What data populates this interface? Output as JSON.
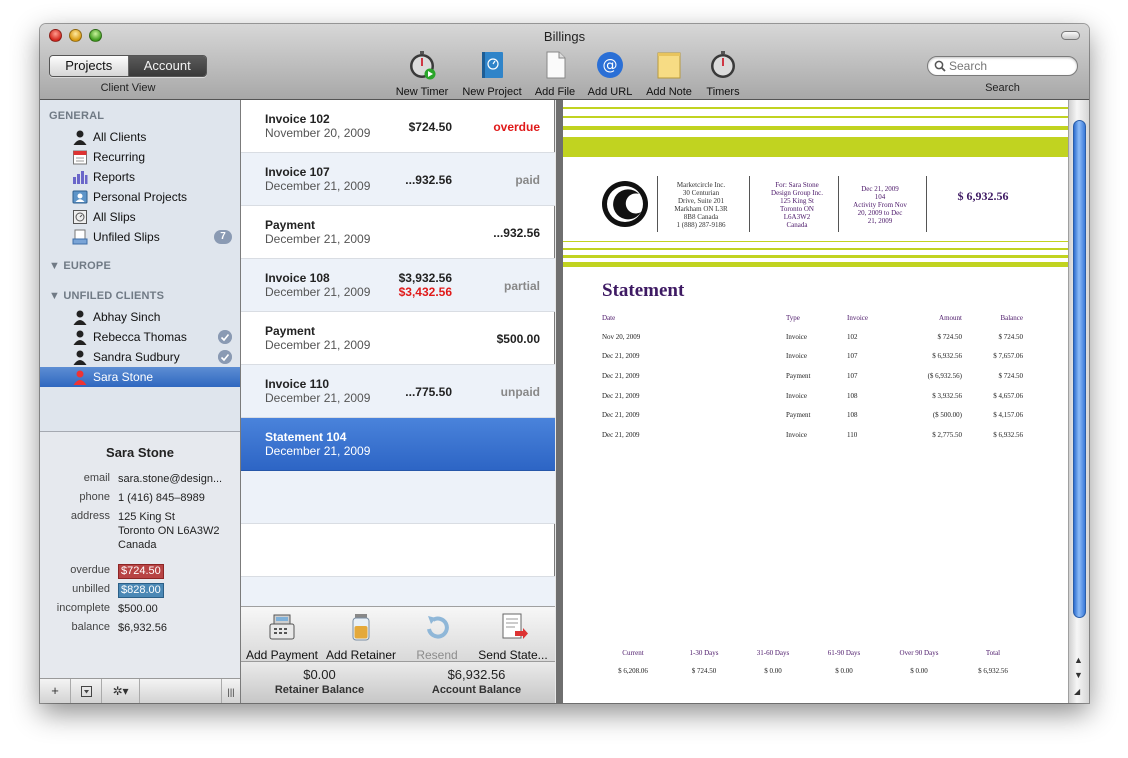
{
  "window": {
    "title": "Billings"
  },
  "toolbar": {
    "seg_projects": "Projects",
    "seg_account": "Account",
    "client_view": "Client View",
    "new_timer": "New Timer",
    "new_project": "New Project",
    "add_file": "Add File",
    "add_url": "Add URL",
    "add_note": "Add Note",
    "timers": "Timers",
    "search_placeholder": "Search",
    "search_label": "Search"
  },
  "sidebar": {
    "general": "GENERAL",
    "items": [
      {
        "label": "All Clients",
        "icon": "person-icon"
      },
      {
        "label": "Recurring",
        "icon": "calendar-icon"
      },
      {
        "label": "Reports",
        "icon": "bar-chart-icon"
      },
      {
        "label": "Personal Projects",
        "icon": "contact-card-icon"
      },
      {
        "label": "All Slips",
        "icon": "slips-icon"
      },
      {
        "label": "Unfiled Slips",
        "icon": "tray-icon",
        "badge": "7"
      }
    ],
    "europe": "EUROPE",
    "unfiled_clients": "UNFILED CLIENTS",
    "clients": [
      {
        "label": "Abhay Sinch"
      },
      {
        "label": "Rebecca Thomas"
      },
      {
        "label": "Sandra Sudbury"
      },
      {
        "label": "Sara Stone"
      }
    ]
  },
  "client": {
    "name": "Sara Stone",
    "email_label": "email",
    "email": "sara.stone@design...",
    "phone_label": "phone",
    "phone": "1 (416) 845–8989",
    "address_label": "address",
    "address_1": "125 King St",
    "address_2": "Toronto ON L6A3W2",
    "address_3": "Canada",
    "overdue_label": "overdue",
    "overdue": "$724.50",
    "unbilled_label": "unbilled",
    "unbilled": "$828.00",
    "incomplete_label": "incomplete",
    "incomplete": "$500.00",
    "balance_label": "balance",
    "balance": "$6,932.56"
  },
  "transactions": [
    {
      "title": "Invoice 102",
      "date": "November 20, 2009",
      "amount": "$724.50",
      "amount2": "",
      "status": "overdue"
    },
    {
      "title": "Invoice 107",
      "date": "December 21, 2009",
      "amount": "...932.56",
      "amount2": "",
      "status": "paid"
    },
    {
      "title": "Payment",
      "date": "December 21, 2009",
      "amount": "...932.56",
      "amount2": "",
      "status": ""
    },
    {
      "title": "Invoice 108",
      "date": "December 21, 2009",
      "amount": "$3,932.56",
      "amount2": "$3,432.56",
      "status": "partial"
    },
    {
      "title": "Payment",
      "date": "December 21, 2009",
      "amount": "$500.00",
      "amount2": "",
      "status": ""
    },
    {
      "title": "Invoice 110",
      "date": "December 21, 2009",
      "amount": "...775.50",
      "amount2": "",
      "status": "unpaid"
    },
    {
      "title": "Statement 104",
      "date": "December 21, 2009",
      "amount": "",
      "amount2": "",
      "status": ""
    }
  ],
  "actions": {
    "add_payment": "Add Payment",
    "add_retainer": "Add Retainer",
    "resend": "Resend",
    "send_statement": "Send State..."
  },
  "balances": {
    "retainer_value": "$0.00",
    "retainer_label": "Retainer Balance",
    "account_value": "$6,932.56",
    "account_label": "Account Balance"
  },
  "statement": {
    "from_1": "Marketcircle Inc.",
    "from_2": "30 Centurian",
    "from_3": "Drive, Suite 201",
    "from_4": "Markham ON L3R",
    "from_5": "8B8 Canada",
    "from_6": "1 (888) 287-9186",
    "for_1": "For: Sara Stone",
    "for_2": "Design Group Inc.",
    "for_3": "125 King St",
    "for_4": "Toronto ON",
    "for_5": "L6A3W2",
    "for_6": "Canada",
    "meta_1": "Dec 21, 2009",
    "meta_2": "104",
    "meta_3": "Activity From Nov",
    "meta_4": "20, 2009 to Dec",
    "meta_5": "21, 2009",
    "total": "$ 6,932.56",
    "title": "Statement",
    "headers": [
      "Date",
      "Type",
      "Invoice",
      "Amount",
      "Balance"
    ],
    "rows": [
      [
        "Nov 20, 2009",
        "Invoice",
        "102",
        "$ 724.50",
        "$ 724.50"
      ],
      [
        "Dec 21, 2009",
        "Invoice",
        "107",
        "$ 6,932.56",
        "$ 7,657.06"
      ],
      [
        "Dec 21, 2009",
        "Payment",
        "107",
        "($ 6,932.56)",
        "$ 724.50"
      ],
      [
        "Dec 21, 2009",
        "Invoice",
        "108",
        "$ 3,932.56",
        "$ 4,657.06"
      ],
      [
        "Dec 21, 2009",
        "Payment",
        "108",
        "($ 500.00)",
        "$ 4,157.06"
      ],
      [
        "Dec 21, 2009",
        "Invoice",
        "110",
        "$ 2,775.50",
        "$ 6,932.56"
      ]
    ],
    "aging_headers": [
      "Current",
      "1-30 Days",
      "31-60 Days",
      "61-90 Days",
      "Over 90 Days",
      "Total"
    ],
    "aging_values": [
      "$ 6,208.06",
      "$ 724.50",
      "$ 0.00",
      "$ 0.00",
      "$ 0.00",
      "$ 6,932.56"
    ]
  },
  "colors": {
    "accent_green": "#c1d320",
    "statement_purple": "#3e1a63",
    "selection_blue": "#2f67c0",
    "overdue_red": "#e01a1a"
  }
}
